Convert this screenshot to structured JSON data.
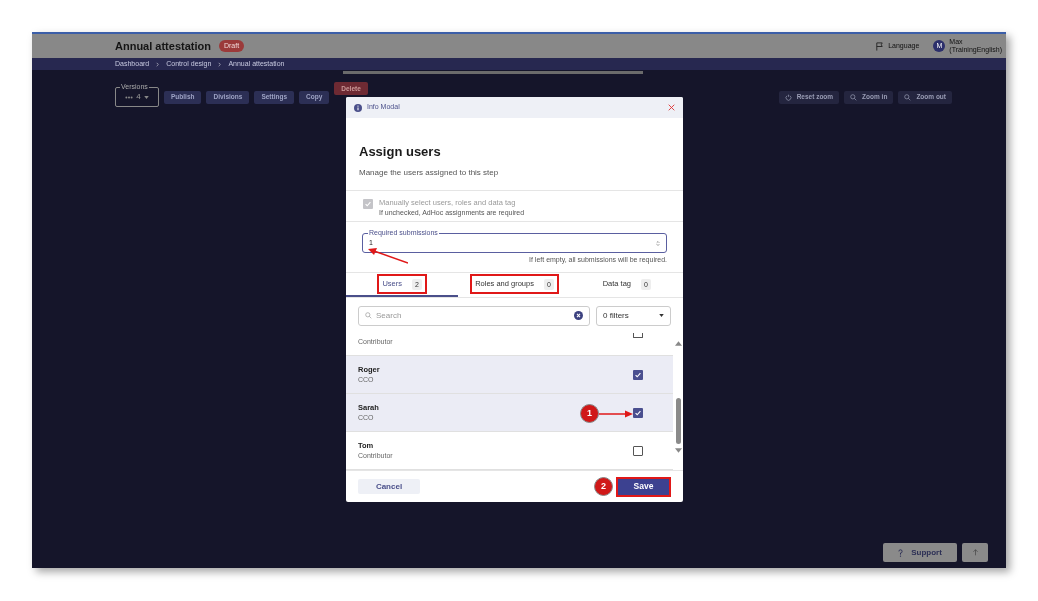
{
  "header": {
    "title": "Annual attestation",
    "status_badge": "Draft",
    "language": "Language",
    "user": {
      "avatar": "M",
      "name": "Max",
      "account": "(TrainingEnglish)"
    }
  },
  "breadcrumbs": [
    "Dashboard",
    "Control design",
    "Annual attestation"
  ],
  "toolbar": {
    "versions": {
      "label": "Versions",
      "value": "4"
    },
    "buttons": [
      {
        "label": "Publish",
        "kind": "normal"
      },
      {
        "label": "Divisions",
        "kind": "normal"
      },
      {
        "label": "Settings",
        "kind": "normal"
      },
      {
        "label": "Copy",
        "kind": "normal"
      },
      {
        "label": "Delete",
        "kind": "danger"
      }
    ],
    "zoom_buttons": [
      {
        "label": "Reset zoom",
        "kind": "reset"
      },
      {
        "label": "Zoom in",
        "kind": "in"
      },
      {
        "label": "Zoom out",
        "kind": "out"
      }
    ]
  },
  "modal": {
    "caption": "Info Modal",
    "title": "Assign users",
    "subtitle": "Manage the users assigned to this step",
    "manual_select": {
      "label": "Manually select users, roles and data tag",
      "hint": "If unchecked, AdHoc assignments are required",
      "checked": true,
      "disabled": true
    },
    "required_submissions": {
      "label": "Required submissions",
      "value": "1",
      "helper": "If left empty, all submissions will be required."
    },
    "tabs": [
      {
        "label": "Users",
        "count": "2",
        "selected": true,
        "highlighted": true
      },
      {
        "label": "Roles and groups",
        "count": "0",
        "selected": false,
        "highlighted": true
      },
      {
        "label": "Data tag",
        "count": "0",
        "selected": false,
        "highlighted": false
      }
    ],
    "search": {
      "placeholder": "Search"
    },
    "filter": "0 filters",
    "users": [
      {
        "role": "Contributor",
        "checked": false,
        "partial": true
      },
      {
        "name": "Roger",
        "role": "CCO",
        "checked": true,
        "partial": false
      },
      {
        "name": "Sarah",
        "role": "CCO",
        "checked": true,
        "partial": false
      },
      {
        "name": "Tom",
        "role": "Contributor",
        "checked": false,
        "partial": false
      }
    ],
    "cancel": "Cancel",
    "save": "Save"
  },
  "annotations": [
    {
      "number": "1"
    },
    {
      "number": "2"
    }
  ],
  "support": "Support"
}
